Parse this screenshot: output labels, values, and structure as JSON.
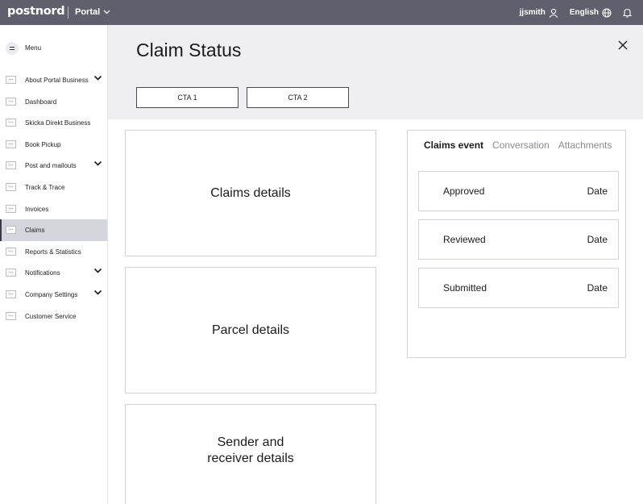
{
  "topbar": {
    "logo": "postnord",
    "portal_label": "Portal",
    "username": "jjsmith",
    "language": "English"
  },
  "sidebar": {
    "menu_label": "Menu",
    "items": [
      {
        "label": "About Portal Business",
        "has_chevron": true,
        "active": false
      },
      {
        "label": "Dashboard",
        "has_chevron": false,
        "active": false
      },
      {
        "label": "Skicka Direkt Business",
        "has_chevron": false,
        "active": false
      },
      {
        "label": "Book Pickup",
        "has_chevron": false,
        "active": false
      },
      {
        "label": "Post and mailouts",
        "has_chevron": true,
        "active": false
      },
      {
        "label": "Track & Trace",
        "has_chevron": false,
        "active": false
      },
      {
        "label": "Invoices",
        "has_chevron": false,
        "active": false
      },
      {
        "label": "Claims",
        "has_chevron": false,
        "active": true
      },
      {
        "label": "Reports & Statistics",
        "has_chevron": false,
        "active": false
      },
      {
        "label": "Notifications",
        "has_chevron": true,
        "active": false
      },
      {
        "label": "Company Settings",
        "has_chevron": true,
        "active": false
      },
      {
        "label": "Customer Service",
        "has_chevron": false,
        "active": false
      }
    ]
  },
  "header": {
    "title": "Claim Status",
    "cta1_label": "CTA 1",
    "cta2_label": "CTA 2"
  },
  "cards": {
    "claims_details": "Claims details",
    "parcel_details": "Parcel details",
    "sender_receiver_line1": "Sender and",
    "sender_receiver_line2": "receiver details"
  },
  "events_panel": {
    "tabs": [
      "Claims event",
      "Conversation",
      "Attachments"
    ],
    "active_tab": "Claims event",
    "events": [
      {
        "status": "Approved",
        "date": "Date"
      },
      {
        "status": "Reviewed",
        "date": "Date"
      },
      {
        "status": "Submitted",
        "date": "Date"
      }
    ]
  },
  "colors": {
    "topbar_bg": "#5f5f6d",
    "header_bg": "#efeff2",
    "active_nav_bg": "#d5d5de"
  }
}
